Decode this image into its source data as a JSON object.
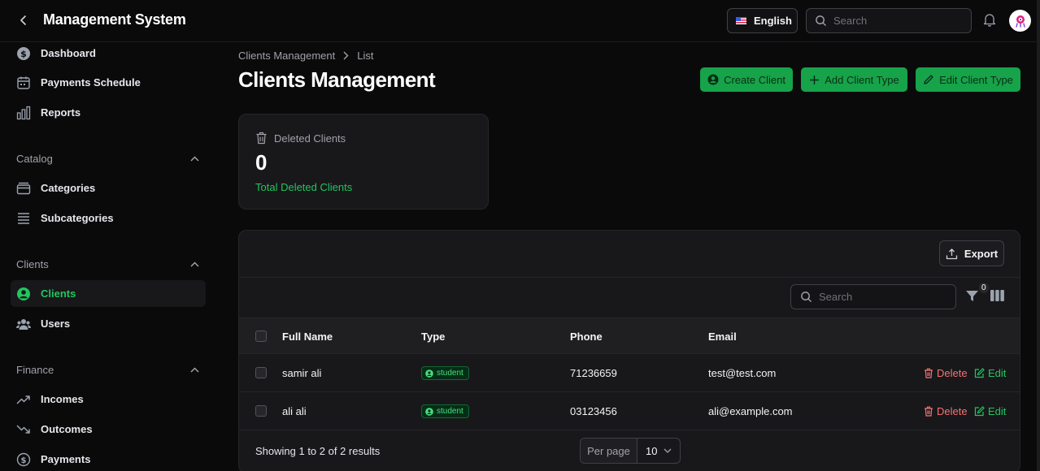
{
  "header": {
    "title": "Management System",
    "language": "English",
    "search_placeholder": "Search"
  },
  "sidebar": {
    "top_items": [
      {
        "label": "Dashboard",
        "icon": "dollar-circle-icon"
      },
      {
        "label": "Payments Schedule",
        "icon": "calendar-icon"
      },
      {
        "label": "Reports",
        "icon": "bar-chart-icon"
      }
    ],
    "groups": [
      {
        "label": "Catalog",
        "items": [
          {
            "label": "Categories",
            "icon": "folder-icon"
          },
          {
            "label": "Subcategories",
            "icon": "list-icon"
          }
        ]
      },
      {
        "label": "Clients",
        "items": [
          {
            "label": "Clients",
            "icon": "user-circle-icon",
            "active": true
          },
          {
            "label": "Users",
            "icon": "users-icon"
          }
        ]
      },
      {
        "label": "Finance",
        "items": [
          {
            "label": "Incomes",
            "icon": "trending-up-icon"
          },
          {
            "label": "Outcomes",
            "icon": "trending-down-icon"
          },
          {
            "label": "Payments",
            "icon": "dollar-circle-icon"
          }
        ]
      }
    ]
  },
  "breadcrumb": {
    "parent": "Clients Management",
    "current": "List"
  },
  "page": {
    "title": "Clients Management",
    "actions": {
      "create": "Create Client",
      "add_type": "Add Client Type",
      "edit_type": "Edit Client Type"
    }
  },
  "stat": {
    "label": "Deleted Clients",
    "value": "0",
    "description": "Total Deleted Clients"
  },
  "table": {
    "export_label": "Export",
    "search_placeholder": "Search",
    "filter_count": "0",
    "columns": [
      "Full Name",
      "Type",
      "Phone",
      "Email"
    ],
    "rows": [
      {
        "name": "samir ali",
        "type": "student",
        "phone": "71236659",
        "email": "test@test.com"
      },
      {
        "name": "ali ali",
        "type": "student",
        "phone": "03123456",
        "email": "ali@example.com"
      }
    ],
    "delete_label": "Delete",
    "edit_label": "Edit",
    "footer": "Showing 1 to 2 of 2 results",
    "per_page_label": "Per page",
    "per_page_value": "10"
  },
  "colors": {
    "accent": "#16a34a",
    "danger": "#f87171",
    "background": "#0a0a0b",
    "card": "#18181b"
  }
}
